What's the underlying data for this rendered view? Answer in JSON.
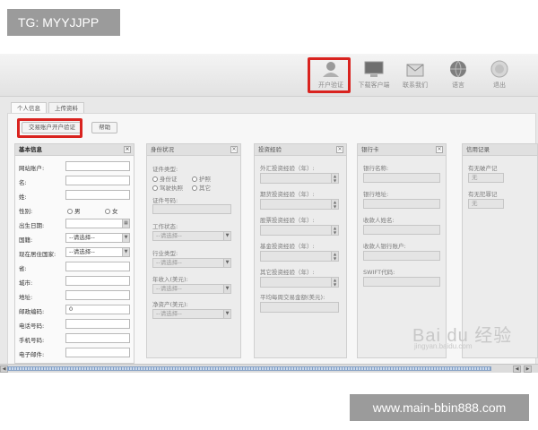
{
  "overlay": {
    "tg_label": "TG: MYYJJPP",
    "url_label": "www.main-bbin888.com"
  },
  "toolbar": {
    "items": [
      {
        "label": "开户验证",
        "icon": "account-verify-icon"
      },
      {
        "label": "下载客户端",
        "icon": "download-client-icon"
      },
      {
        "label": "联系我们",
        "icon": "mail-icon"
      },
      {
        "label": "语言",
        "icon": "globe-icon"
      },
      {
        "label": "退出",
        "icon": "power-icon"
      }
    ]
  },
  "tabs": [
    "个人信息",
    "上传资料"
  ],
  "actions": {
    "open_account": "交易账户开户验证",
    "help": "帮助"
  },
  "panels": {
    "basic": {
      "title": "基本信息",
      "fields": {
        "website_account": "网站账户:",
        "first_name": "名:",
        "last_name": "姓:",
        "gender": "性别:",
        "gender_male": "男",
        "gender_female": "女",
        "birthdate": "出生日期:",
        "nationality": "国籍:",
        "residence_country": "现在居住国家:",
        "province": "省:",
        "city": "城市:",
        "address": "地址:",
        "postcode": "邮政编码:",
        "phone": "电话号码:",
        "mobile": "手机号码:",
        "email": "电子邮件:"
      },
      "select_placeholder": "--请选择--",
      "postcode_value": "0"
    },
    "identity": {
      "title": "身份状况",
      "id_type_label": "证件类型:",
      "id_options": [
        "身份证",
        "护照",
        "驾驶执照",
        "其它"
      ],
      "id_number_label": "证件号码:",
      "work_status_label": "工作状态:",
      "industry_label": "行业类型:",
      "annual_income_label": "年收入(美元):",
      "net_assets_label": "净资产(美元):",
      "select_placeholder": "--请选择--"
    },
    "invest": {
      "title": "投资经验",
      "items": [
        "外汇投资经验（年）:",
        "期货投资经验（年）:",
        "股票投资经验（年）:",
        "基金投资经验（年）:",
        "其它投资经验（年）:",
        "平均每周交易金额(美元):"
      ]
    },
    "bank": {
      "title": "银行卡",
      "items": [
        "银行名称:",
        "银行地址:",
        "收款人姓名:",
        "收款人银行账户:",
        "SWIFT代码:"
      ]
    },
    "credit": {
      "title": "信用记录",
      "items": [
        "有无破产记",
        "有无犯罪记"
      ],
      "values": [
        "无",
        "无"
      ]
    }
  },
  "watermark": {
    "brand": "Bai du 经验",
    "sub": "jingyan.baidu.com"
  }
}
